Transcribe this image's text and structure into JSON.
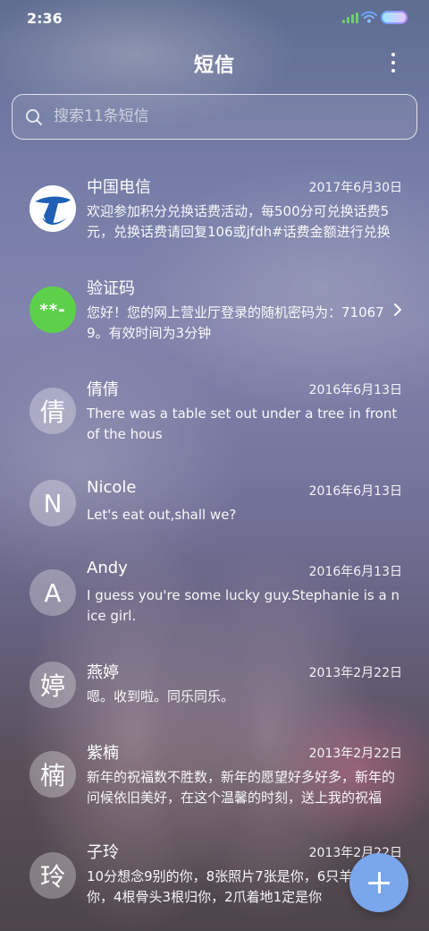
{
  "status_bar": {
    "time": "2:36"
  },
  "header": {
    "title": "短信"
  },
  "search": {
    "placeholder": "搜索11条短信",
    "value": ""
  },
  "conversations": [
    {
      "name": "中国电信",
      "date": "2017年6月30日",
      "preview": "欢迎参加积分兑换话费活动，每500分可兑换话费5元，兑换话费请回复106或jfdh#话费金额进行兑换",
      "avatar": "telecom-logo"
    },
    {
      "name": "验证码",
      "date": "",
      "preview": "您好！您的网上营业厅登录的随机密码为：710679。有效时间为3分钟",
      "avatar": "**-"
    },
    {
      "name": "倩倩",
      "date": "2016年6月13日",
      "preview": "There was a table set out under a tree in front of the hous",
      "avatar": "倩"
    },
    {
      "name": "Nicole",
      "date": "2016年6月13日",
      "preview": "Let's eat out,shall we?",
      "avatar": "N"
    },
    {
      "name": "Andy",
      "date": "2016年6月13日",
      "preview": "I guess you're some lucky guy.Stephanie is a nice girl.",
      "avatar": "A"
    },
    {
      "name": "燕婷",
      "date": "2013年2月22日",
      "preview": "嗯。收到啦。同乐同乐。",
      "avatar": "婷"
    },
    {
      "name": "紫楠",
      "date": "2013年2月22日",
      "preview": "新年的祝福数不胜数，新年的愿望好多好多，新年的问候依旧美好，在这个温馨的时刻，送上我的祝福",
      "avatar": "楠"
    },
    {
      "name": "子玲",
      "date": "2013年2月22日",
      "preview": "10分想念9别的你，8张照片7张是你，6只羊只像你，4根骨头3根归你，2爪着地1定是你",
      "avatar": "玲"
    }
  ],
  "colors": {
    "fab": "#7aa6ec",
    "verification_avatar": "#5cd04a",
    "telecom_blue": "#1f5fb4"
  },
  "icons": {
    "search": "search-icon",
    "more": "more-vertical-icon",
    "chevron": "chevron-right-icon",
    "compose": "plus-icon"
  }
}
